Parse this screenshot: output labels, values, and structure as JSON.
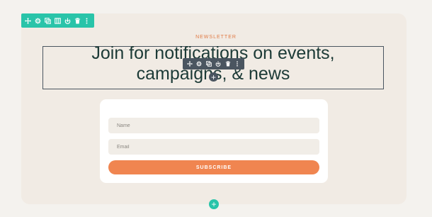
{
  "section_toolbar": {
    "icons": [
      "move-icon",
      "settings-icon",
      "duplicate-icon",
      "columns-icon",
      "save-icon",
      "delete-icon",
      "more-icon"
    ]
  },
  "newsletter": {
    "eyebrow": "NEWSLETTER",
    "heading_line1": "Join for notifications on events,",
    "heading_line2": "campaigns, & news"
  },
  "element_toolbar": {
    "icons": [
      "move-icon",
      "settings-icon",
      "duplicate-icon",
      "save-icon",
      "delete-icon",
      "more-icon"
    ]
  },
  "form": {
    "name_placeholder": "Name",
    "name_value": "",
    "email_placeholder": "Email",
    "email_value": "",
    "subscribe_label": "SUBSCRIBE"
  },
  "add_glyph": "+",
  "colors": {
    "accent_teal": "#29c4a9",
    "button_orange": "#f08550",
    "eyebrow_orange": "#e07a45",
    "heading_dark": "#1c3a36",
    "section_bg": "#f1ebe4"
  }
}
